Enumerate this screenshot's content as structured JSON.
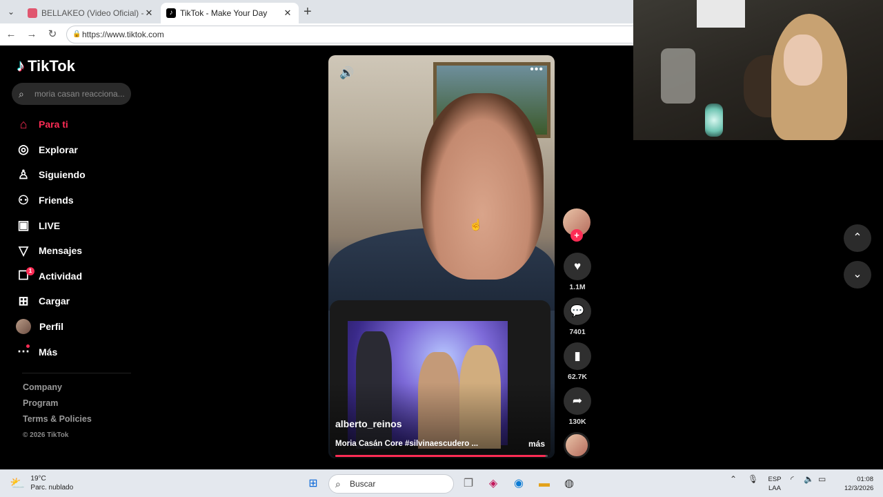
{
  "browser": {
    "tabs": [
      {
        "title": "BELLAKEO (Video Oficial) - Peso Pluma",
        "active": false
      },
      {
        "title": "TikTok - Make Your Day",
        "active": true
      }
    ],
    "url": "https://www.tiktok.com"
  },
  "tiktok": {
    "logo": "TikTok",
    "search_placeholder": "moria casan reacciona...",
    "nav": [
      {
        "label": "Para ti",
        "icon": "home-icon",
        "active": true
      },
      {
        "label": "Explorar",
        "icon": "compass-icon"
      },
      {
        "label": "Siguiendo",
        "icon": "following-icon"
      },
      {
        "label": "Friends",
        "icon": "friends-icon"
      },
      {
        "label": "LIVE",
        "icon": "live-icon"
      },
      {
        "label": "Mensajes",
        "icon": "messages-icon"
      },
      {
        "label": "Actividad",
        "icon": "activity-icon",
        "badge": "1"
      },
      {
        "label": "Cargar",
        "icon": "upload-icon"
      },
      {
        "label": "Perfil",
        "icon": "avatar"
      },
      {
        "label": "Más",
        "icon": "more-icon"
      }
    ],
    "footer": {
      "links": [
        "Company",
        "Program",
        "Terms & Policies"
      ],
      "copyright": "© 2026 TikTok"
    },
    "video": {
      "username": "alberto_reinos",
      "description": "Moria Casán Core #silvinaescudero ...",
      "more": "más",
      "progress": 0.99
    },
    "actions": {
      "likes": "1.1M",
      "comments": "7401",
      "saves": "62.7K",
      "shares": "130K"
    },
    "accent": "#fe2c55"
  },
  "taskbar": {
    "weather_temp": "19°C",
    "weather_desc": "Parc. nublado",
    "search": "Buscar",
    "lang1": "ESP",
    "lang2": "LAA",
    "time": "01:08",
    "date": "12/3/2026"
  }
}
